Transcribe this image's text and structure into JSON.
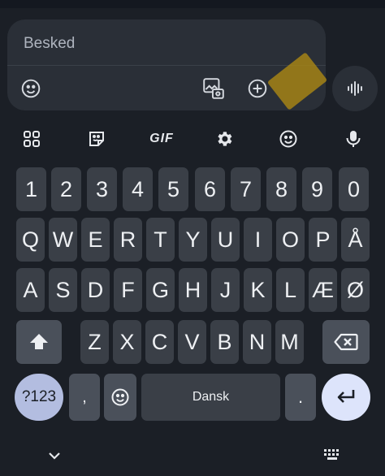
{
  "compose": {
    "placeholder": "Besked"
  },
  "toolbar": {
    "gif_label": "GIF"
  },
  "keys": {
    "numbers": [
      "1",
      "2",
      "3",
      "4",
      "5",
      "6",
      "7",
      "8",
      "9",
      "0"
    ],
    "row1": [
      "Q",
      "W",
      "E",
      "R",
      "T",
      "Y",
      "U",
      "I",
      "O",
      "P",
      "Å"
    ],
    "row2": [
      "A",
      "S",
      "D",
      "F",
      "G",
      "H",
      "J",
      "K",
      "L",
      "Æ",
      "Ø"
    ],
    "row3": [
      "Z",
      "X",
      "C",
      "V",
      "B",
      "N",
      "M"
    ],
    "symbols_label": "?123",
    "comma_label": ",",
    "space_label": "Dansk",
    "period_label": "."
  },
  "colors": {
    "background": "#1b1f26",
    "key": "#3a3f47",
    "function_key": "#4a505a",
    "symbols_key": "#b3bde0",
    "enter_key": "#dde4fb",
    "compose": "#2a2f37",
    "tap_highlight": "#b08a12"
  },
  "icons": [
    "emoji-icon",
    "gallery-attach-icon",
    "add-icon",
    "voice-wave-icon",
    "apps-grid-icon",
    "sticker-icon",
    "settings-icon",
    "emoji-icon",
    "mic-icon",
    "shift-icon",
    "backspace-icon",
    "enter-icon",
    "hide-keyboard-icon",
    "keyboard-icon"
  ]
}
